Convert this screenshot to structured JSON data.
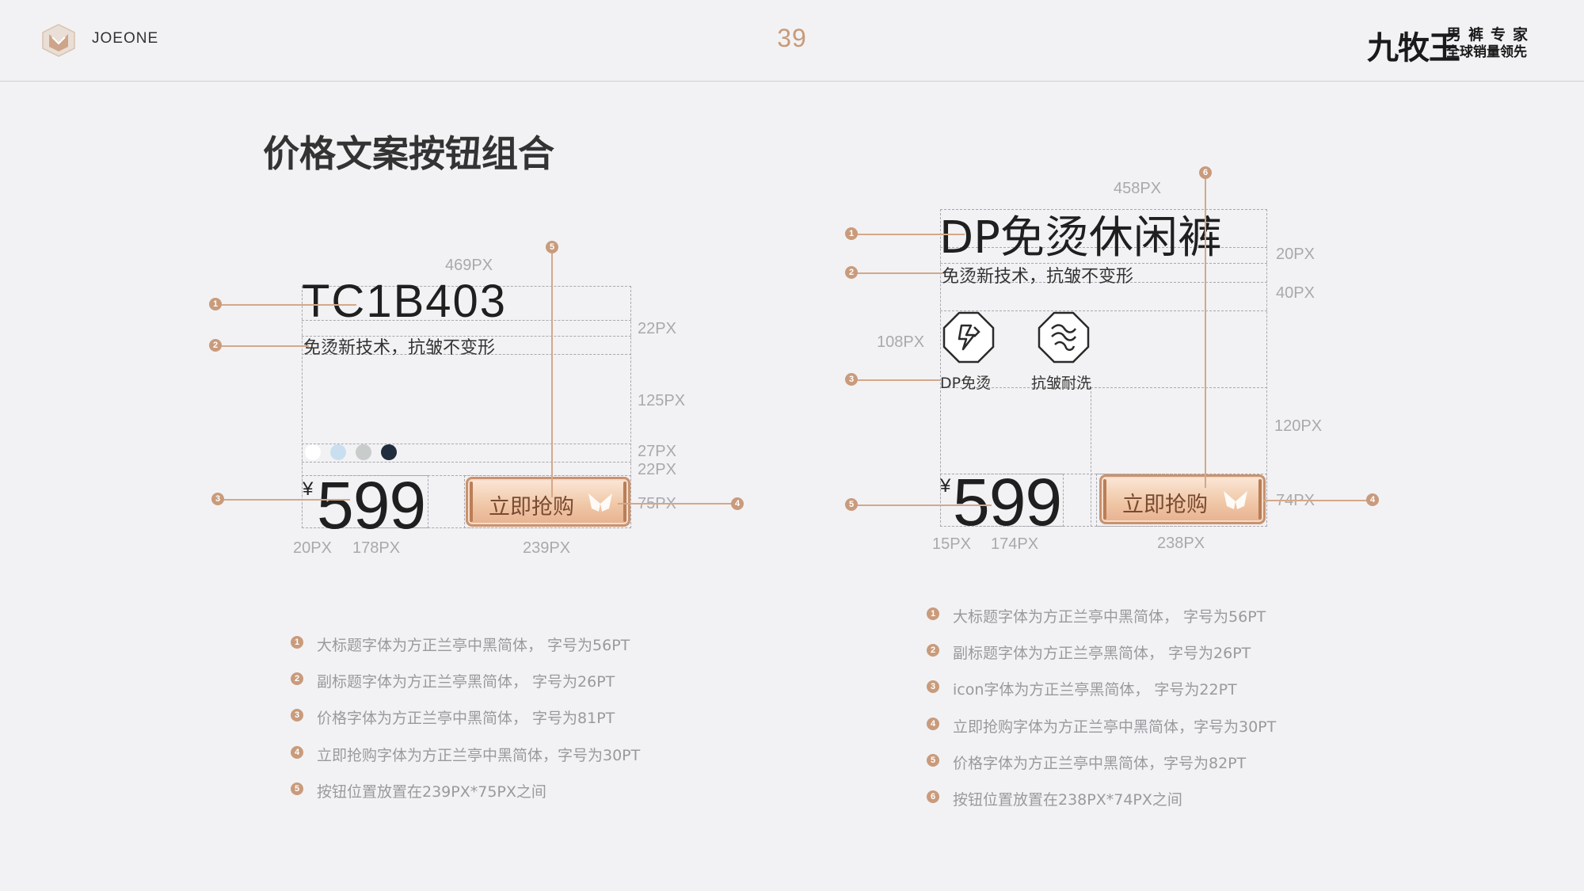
{
  "header": {
    "logo_text": "JOEONE",
    "page_number": "39",
    "brand_main": "九牧王",
    "brand_line1": "男裤专家",
    "brand_line2": "全球销量领先"
  },
  "slide_title": "价格文案按钮组合",
  "left_card": {
    "product_code": "TC1B403",
    "subtitle": "免烫新技术，抗皱不变形",
    "currency": "¥",
    "price": "599",
    "buy_label": "立即抢购",
    "swatch_colors": [
      "#ffffff",
      "#c9dff0",
      "#c8ccca",
      "#1f2d3d"
    ],
    "dims": {
      "width": "469PX",
      "gap_title": "22PX",
      "gap_block": "125PX",
      "swatch_row": "27PX",
      "gap_price": "22PX",
      "button_height": "75PX",
      "yen_width": "20PX",
      "price_width": "178PX",
      "button_width": "239PX"
    },
    "markers": [
      "1",
      "2",
      "3",
      "4",
      "5"
    ]
  },
  "right_card": {
    "product_name": "DP免烫休闲裤",
    "subtitle": "免烫新技术，抗皱不变形",
    "features": [
      {
        "label": "DP免烫",
        "icon": "dp-noniron-icon"
      },
      {
        "label": "抗皱耐洗",
        "icon": "wrinkle-resistant-icon"
      }
    ],
    "currency": "¥",
    "price": "599",
    "buy_label": "立即抢购",
    "dims": {
      "width": "458PX",
      "gap_title": "20PX",
      "gap_sub": "40PX",
      "icon_height": "108PX",
      "gap_block": "120PX",
      "button_height": "74PX",
      "yen_width": "15PX",
      "price_width": "174PX",
      "button_width": "238PX"
    },
    "markers": [
      "1",
      "2",
      "3",
      "4",
      "5",
      "6"
    ]
  },
  "left_notes": [
    {
      "n": "1",
      "text": "大标题字体为方正兰亭中黑简体， 字号为56PT"
    },
    {
      "n": "2",
      "text": "副标题字体为方正兰亭黑简体， 字号为26PT"
    },
    {
      "n": "3",
      "text": "价格字体为方正兰亭中黑简体， 字号为81PT"
    },
    {
      "n": "4",
      "text": "立即抢购字体为方正兰亭中黑简体，字号为30PT"
    },
    {
      "n": "5",
      "text": "按钮位置放置在239PX*75PX之间"
    }
  ],
  "right_notes": [
    {
      "n": "1",
      "text": "大标题字体为方正兰亭中黑简体， 字号为56PT"
    },
    {
      "n": "2",
      "text": "副标题字体为方正兰亭黑简体， 字号为26PT"
    },
    {
      "n": "3",
      "text": "icon字体为方正兰亭黑简体， 字号为22PT"
    },
    {
      "n": "4",
      "text": "立即抢购字体为方正兰亭中黑简体，字号为30PT"
    },
    {
      "n": "5",
      "text": "价格字体为方正兰亭中黑简体，字号为82PT"
    },
    {
      "n": "6",
      "text": "按钮位置放置在238PX*74PX之间"
    }
  ]
}
